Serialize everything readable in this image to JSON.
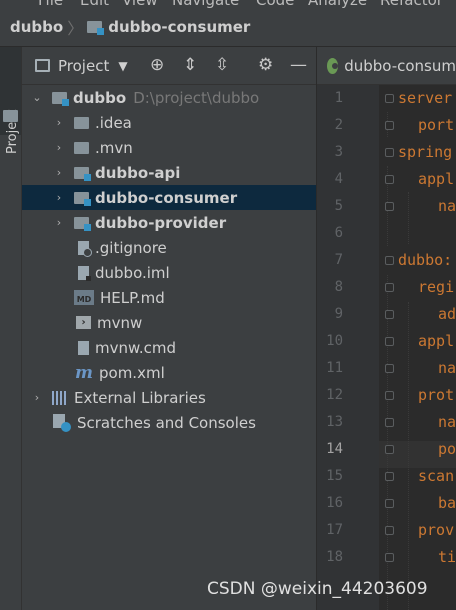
{
  "menubar": [
    "File",
    "Edit",
    "View",
    "Navigate",
    "Code",
    "Analyze",
    "Refactor"
  ],
  "breadcrumb": [
    "dubbo",
    "dubbo-consumer"
  ],
  "toolstrip": {
    "project_tab": "Project"
  },
  "project_panel": {
    "title": "Project",
    "tools": [
      "crosshair-icon",
      "expand-all-icon",
      "collapse-all-icon",
      "gear-icon",
      "minimize-icon"
    ]
  },
  "tree": [
    {
      "name": "dubbo",
      "path": "D:\\project\\dubbo",
      "icon": "module-folder-icon",
      "expanded": true
    },
    {
      "name": ".idea",
      "icon": "folder-icon"
    },
    {
      "name": ".mvn",
      "icon": "folder-icon"
    },
    {
      "name": "dubbo-api",
      "icon": "module-folder-icon"
    },
    {
      "name": "dubbo-consumer",
      "icon": "module-folder-icon",
      "selected": true
    },
    {
      "name": "dubbo-provider",
      "icon": "module-folder-icon"
    },
    {
      "name": ".gitignore",
      "icon": "gitignore-file-icon"
    },
    {
      "name": "dubbo.iml",
      "icon": "iml-file-icon"
    },
    {
      "name": "HELP.md",
      "icon": "markdown-file-icon"
    },
    {
      "name": "mvnw",
      "icon": "shell-file-icon"
    },
    {
      "name": "mvnw.cmd",
      "icon": "file-icon"
    },
    {
      "name": "pom.xml",
      "icon": "maven-file-icon"
    },
    {
      "name": "External Libraries",
      "icon": "libraries-icon"
    },
    {
      "name": "Scratches and Consoles",
      "icon": "scratches-icon"
    }
  ],
  "editor": {
    "tab_label": "dubbo-consum",
    "current_line": 14,
    "lines": [
      {
        "n": "1",
        "text": "server"
      },
      {
        "n": "2",
        "text": "port"
      },
      {
        "n": "3",
        "text": "spring"
      },
      {
        "n": "4",
        "text": "appl"
      },
      {
        "n": "5",
        "text": "na"
      },
      {
        "n": "6",
        "text": ""
      },
      {
        "n": "7",
        "text": "dubbo:"
      },
      {
        "n": "8",
        "text": "regi"
      },
      {
        "n": "9",
        "text": "ad"
      },
      {
        "n": "10",
        "text": "appl"
      },
      {
        "n": "11",
        "text": "na"
      },
      {
        "n": "12",
        "text": "prot"
      },
      {
        "n": "13",
        "text": "na"
      },
      {
        "n": "14",
        "text": "po"
      },
      {
        "n": "15",
        "text": "scan"
      },
      {
        "n": "16",
        "text": "ba"
      },
      {
        "n": "17",
        "text": "prov"
      },
      {
        "n": "18",
        "text": "ti"
      }
    ]
  },
  "watermark": "CSDN @weixin_44203609"
}
